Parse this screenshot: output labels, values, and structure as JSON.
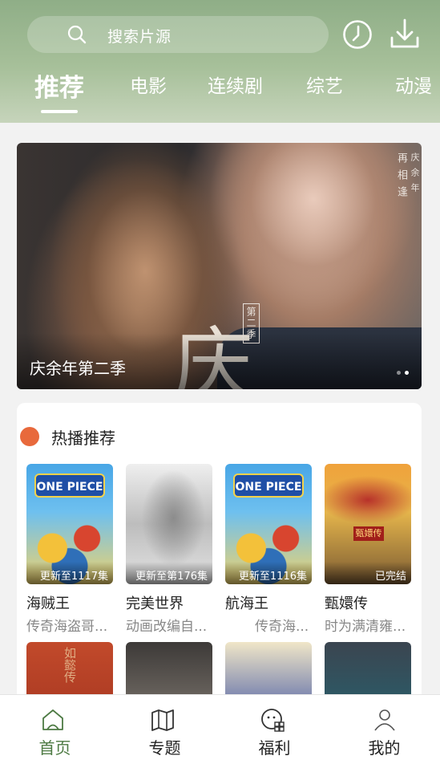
{
  "header": {
    "search_placeholder": "搜索片源",
    "icons": [
      "search-icon",
      "history-icon",
      "download-icon"
    ],
    "tabs": [
      {
        "label": "推荐",
        "active": true
      },
      {
        "label": "电影"
      },
      {
        "label": "连续剧"
      },
      {
        "label": "综艺"
      },
      {
        "label": "动漫"
      }
    ]
  },
  "banner": {
    "title": "庆余年第二季",
    "poster_text_1": "庆",
    "poster_text_2": "第二季",
    "poster_vertical_1": "再相逢",
    "poster_vertical_2": "庆余年",
    "dots": 2,
    "active_dot": 1
  },
  "hot": {
    "title": "热播推荐",
    "accent_color": "#e8693c",
    "items": [
      {
        "title": "海贼王",
        "sub": "传奇海盗哥...",
        "badge": "更新至1117集"
      },
      {
        "title": "完美世界",
        "sub": "动画改编自...",
        "badge": "更新至第176集"
      },
      {
        "title": "航海王",
        "sub": "传奇海...",
        "badge": "更新至1116集"
      },
      {
        "title": "甄嬛传",
        "sub": "时为满清雍...",
        "badge": "已完结"
      }
    ],
    "poster_logo": "ONE PIECE",
    "poster_sign": "甄嬛传",
    "poster_text_row2": "如懿传"
  },
  "bottom_nav": {
    "items": [
      {
        "label": "首页",
        "icon": "home-icon",
        "active": true
      },
      {
        "label": "专题",
        "icon": "map-icon"
      },
      {
        "label": "福利",
        "icon": "gift-face-icon"
      },
      {
        "label": "我的",
        "icon": "user-icon"
      }
    ],
    "active_color": "#4d7a43"
  }
}
